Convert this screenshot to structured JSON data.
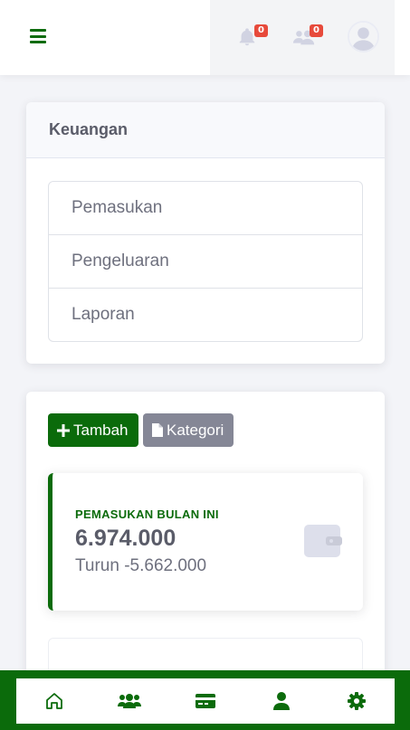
{
  "topbar": {
    "notifications_count": "0",
    "messages_count": "0"
  },
  "menu_card": {
    "title": "Keuangan",
    "items": [
      {
        "label": "Pemasukan"
      },
      {
        "label": "Pengeluaran"
      },
      {
        "label": "Laporan"
      }
    ]
  },
  "actions": {
    "add_label": "Tambah",
    "category_label": "Kategori"
  },
  "stat": {
    "label": "PEMASUKAN BULAN INI",
    "value": "6.974.000",
    "sub": "Turun -5.662.000"
  },
  "bottom_nav": {
    "items": [
      {
        "icon": "home-icon"
      },
      {
        "icon": "users-icon"
      },
      {
        "icon": "credit-card-icon"
      },
      {
        "icon": "user-icon"
      },
      {
        "icon": "gear-icon"
      }
    ]
  },
  "colors": {
    "brand": "#0b6b0b",
    "secondary": "#858796",
    "badge": "#e74a3b"
  }
}
